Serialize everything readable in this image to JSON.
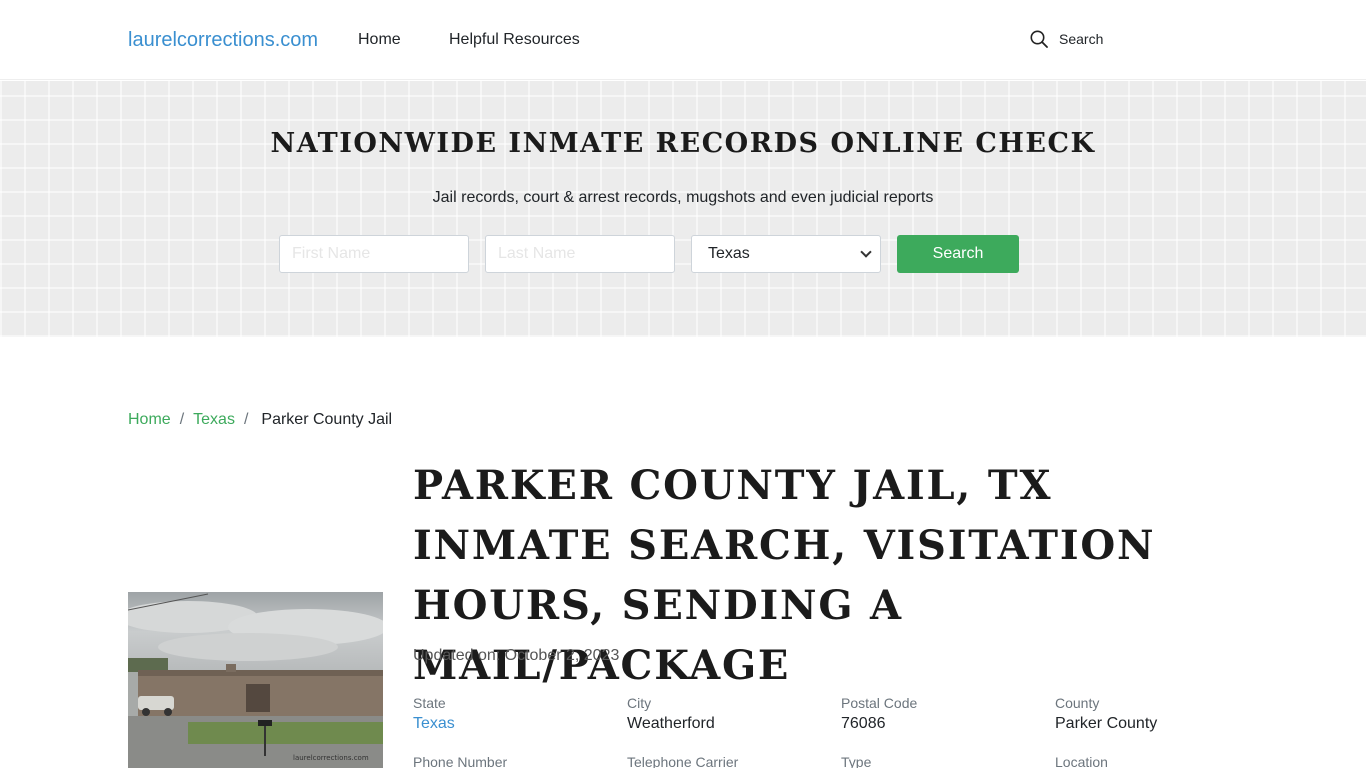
{
  "header": {
    "logo": "laurelcorrections.com",
    "nav": [
      {
        "label": "Home"
      },
      {
        "label": "Helpful Resources"
      }
    ],
    "search_label": "Search"
  },
  "hero": {
    "title": "NATIONWIDE INMATE RECORDS ONLINE CHECK",
    "subtitle": "Jail records, court & arrest records, mugshots and even judicial reports",
    "first_name_placeholder": "First Name",
    "last_name_placeholder": "Last Name",
    "state_selected": "Texas",
    "search_button": "Search"
  },
  "breadcrumb": {
    "home": "Home",
    "state": "Texas",
    "current": "Parker County Jail"
  },
  "photo": {
    "watermark": "laurelcorrections.com"
  },
  "main": {
    "title": "PARKER COUNTY JAIL, TX INMATE SEARCH, VISITATION HOURS, SENDING A MAIL/PACKAGE",
    "updated": "Updated on: October 2, 2023",
    "info_row1": [
      {
        "label": "State",
        "value": "Texas"
      },
      {
        "label": "City",
        "value": "Weatherford"
      },
      {
        "label": "Postal Code",
        "value": "76086"
      },
      {
        "label": "County",
        "value": "Parker County"
      }
    ],
    "info_row2": [
      {
        "label": "Phone Number"
      },
      {
        "label": "Telephone Carrier"
      },
      {
        "label": "Type"
      },
      {
        "label": "Location"
      }
    ]
  },
  "colors": {
    "accent_green": "#3daa5c",
    "link_blue": "#3a8fd0"
  }
}
